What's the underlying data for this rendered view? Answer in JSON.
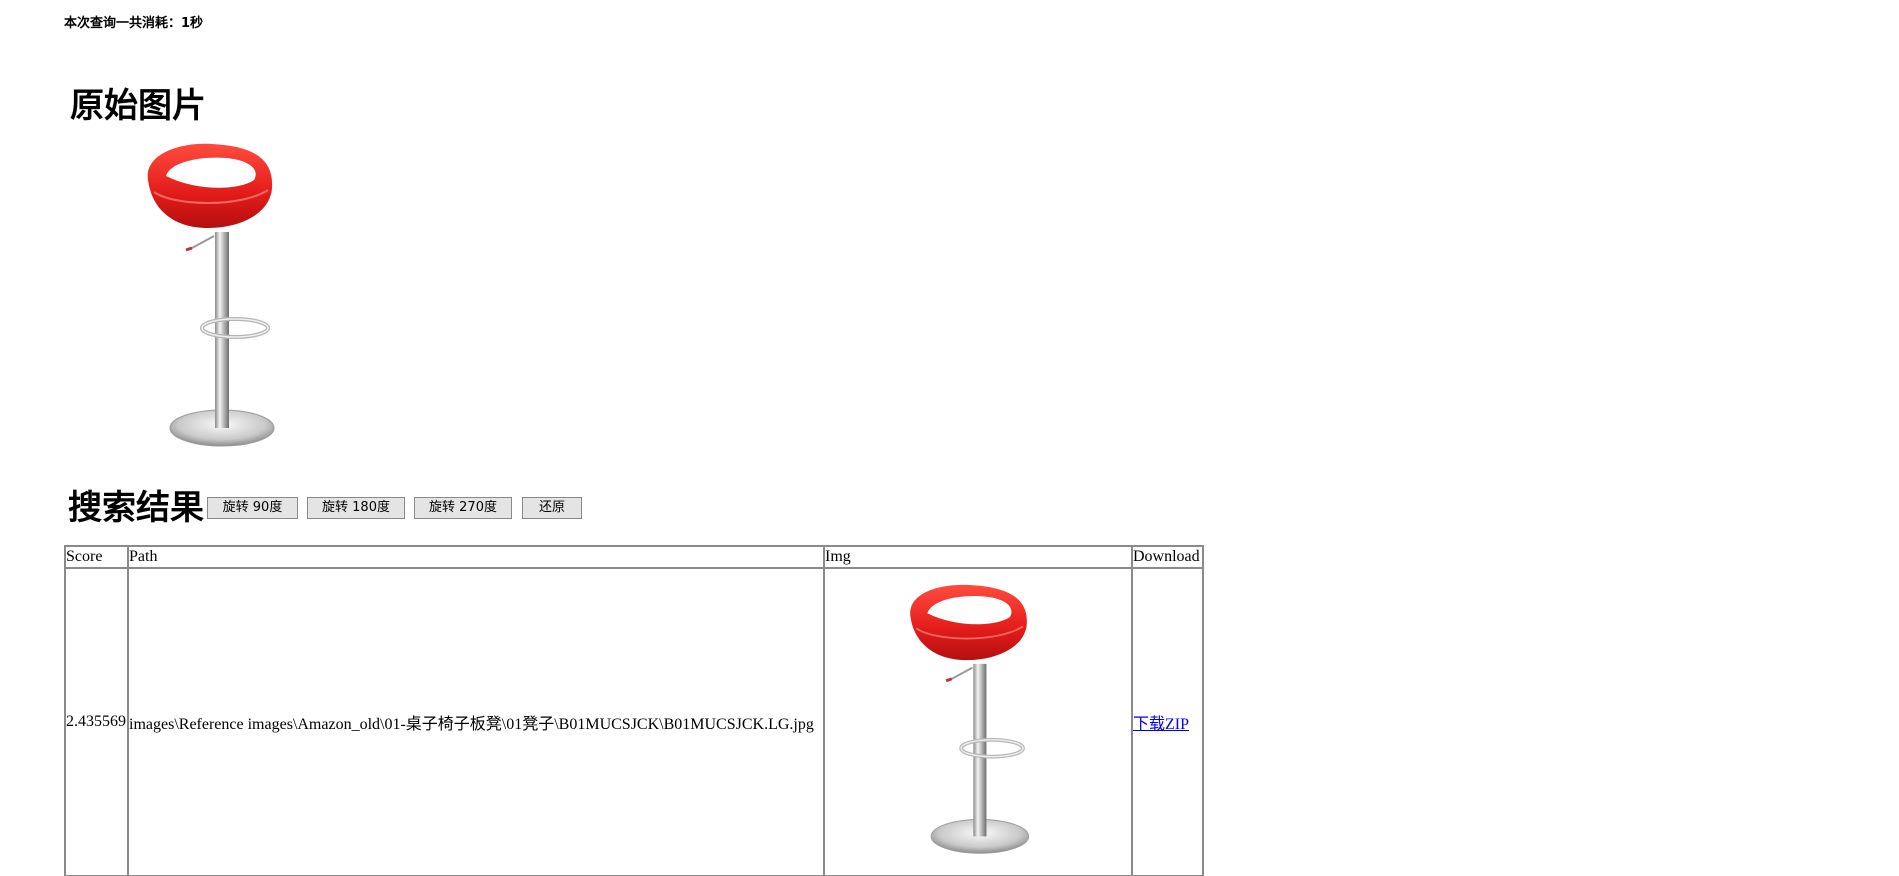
{
  "query_time": "本次查询一共消耗：1秒",
  "original_section": {
    "title": "原始图片",
    "image_alt": "red bar stool"
  },
  "results_section": {
    "title": "搜索结果",
    "buttons": {
      "rotate_90": "旋转 90度",
      "rotate_180": "旋转 180度",
      "rotate_270": "旋转 270度",
      "reset": "还原"
    }
  },
  "table": {
    "headers": {
      "score": "Score",
      "path": "Path",
      "img": "Img",
      "download": "Download"
    },
    "rows": [
      {
        "score": "2.435569",
        "path": "images\\Reference images\\Amazon_old\\01-桌子椅子板凳\\01凳子\\B01MUCSJCK\\B01MUCSJCK.LG.jpg",
        "download_label": "下载ZIP"
      }
    ]
  },
  "colors": {
    "seat_red": "#e8201f",
    "chrome": "#c8c8c8",
    "link": "#0000ee",
    "border": "#8a8a8a",
    "button_bg": "#e4e4e4"
  }
}
